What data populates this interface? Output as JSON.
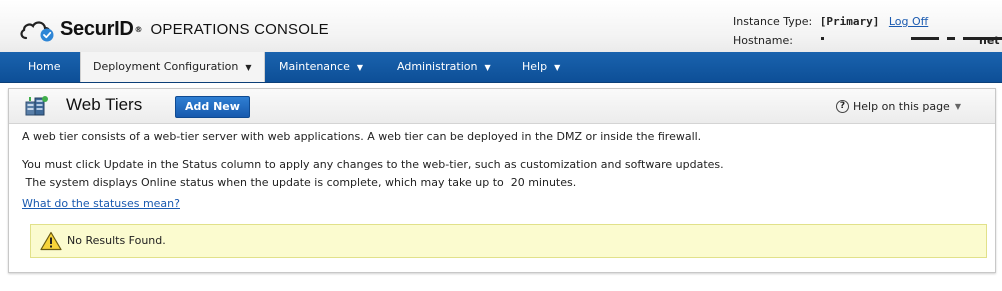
{
  "header": {
    "brand": "SecurID",
    "console_title": "OPERATIONS CONSOLE",
    "instance_type_label": "Instance Type:",
    "instance_type_value": "[Primary]",
    "log_off": "Log Off",
    "hostname_label": "Hostname:",
    "hostname_tail": "net"
  },
  "nav": {
    "home": "Home",
    "deployment": "Deployment Configuration",
    "maintenance": "Maintenance",
    "administration": "Administration",
    "help": "Help"
  },
  "panel": {
    "title": "Web Tiers",
    "add_new": "Add New",
    "help_link": "Help on this page",
    "line1": "A web tier consists of a web-tier server with web applications. A web tier can be deployed in the DMZ or inside the firewall.",
    "line2": "You must click Update in the Status column to apply any changes to the web-tier, such as customization and software updates.",
    "line3": " The system displays Online status when the update is complete, which may take up to  20 minutes.",
    "status_link": "What do the statuses mean?",
    "no_results": "No Results Found."
  },
  "colors": {
    "nav_blue": "#1259a3",
    "link_blue": "#1a5ab0",
    "warning_bg": "#fbfbcf"
  },
  "icons": {
    "logo": "cloud-check-icon",
    "panel": "server-stack-icon",
    "help": "question-circle-icon",
    "warning": "warning-triangle-icon"
  }
}
